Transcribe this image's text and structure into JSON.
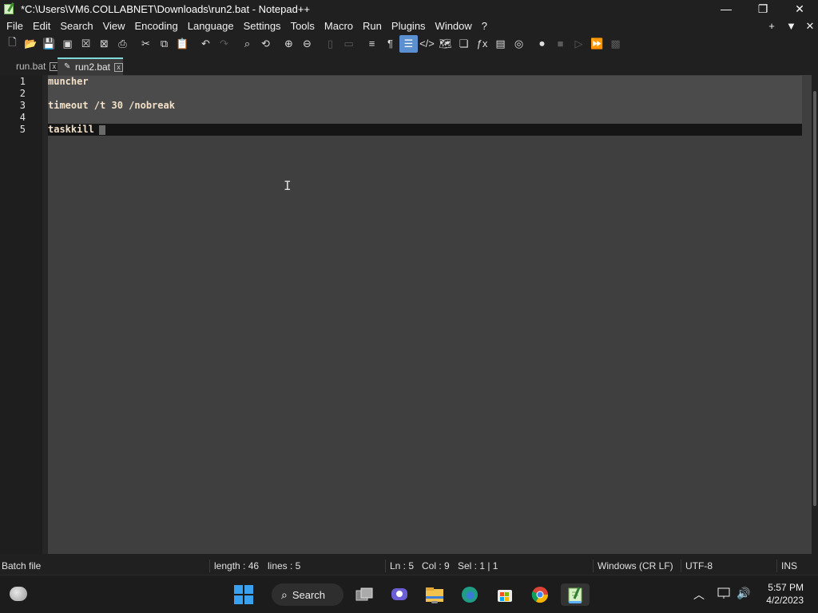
{
  "window": {
    "title": "*C:\\Users\\VM6.COLLABNET\\Downloads\\run2.bat - Notepad++",
    "minimize": "—",
    "maximize": "❐",
    "close": "✕"
  },
  "menu": {
    "items": [
      "File",
      "Edit",
      "Search",
      "View",
      "Encoding",
      "Language",
      "Settings",
      "Tools",
      "Macro",
      "Run",
      "Plugins",
      "Window",
      "?"
    ],
    "right": [
      "+",
      "▼",
      "✕"
    ]
  },
  "toolbar": {
    "icons": [
      "new-file-icon",
      "open-file-icon",
      "save-icon",
      "save-all-icon",
      "close-icon",
      "close-all-icon",
      "print-icon",
      "cut-icon",
      "copy-icon",
      "paste-icon",
      "undo-icon",
      "redo-icon",
      "find-icon",
      "replace-icon",
      "zoom-in-icon",
      "zoom-out-icon",
      "sync-vertical-icon",
      "sync-horizontal-icon",
      "word-wrap-icon",
      "show-all-chars-icon",
      "indent-guide-icon",
      "xml-tag-icon",
      "document-map-icon",
      "document-list-icon",
      "function-list-icon",
      "monitor-icon",
      "folder-as-workspace-icon",
      "record-macro-icon",
      "stop-record-icon",
      "play-macro-icon",
      "run-macro-multiple-icon",
      "save-macro-icon"
    ]
  },
  "tabs": [
    {
      "label": "run.bat",
      "close": "x"
    },
    {
      "label": "run2.bat",
      "close": "x",
      "pencil": "✎"
    }
  ],
  "editor": {
    "line_numbers": [
      "1",
      "2",
      "3",
      "4",
      "5"
    ],
    "lines": [
      "muncher",
      "",
      "timeout /t 30 /nobreak",
      "",
      "taskkill"
    ]
  },
  "status": {
    "filetype": "Batch file",
    "length": "length : 46",
    "lines": "lines : 5",
    "ln": "Ln : 5",
    "col": "Col : 9",
    "sel": "Sel : 1 | 1",
    "eol": "Windows (CR LF)",
    "encoding": "UTF-8",
    "mode": "INS"
  },
  "taskbar": {
    "search_label": "Search",
    "time": "5:57 PM",
    "date": "4/2/2023"
  },
  "colors": {
    "accent_tab": "#7fd9d9",
    "change_marker": "#e0823a",
    "start_blue": "#3aa0f0"
  }
}
